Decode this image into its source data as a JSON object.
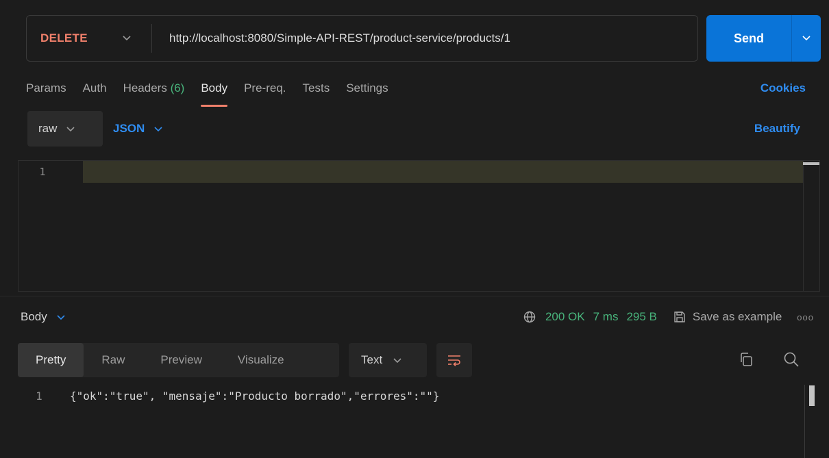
{
  "request": {
    "method": "DELETE",
    "url": "http://localhost:8080/Simple-API-REST/product-service/products/1",
    "send_label": "Send"
  },
  "tabs": [
    {
      "label": "Params"
    },
    {
      "label": "Auth"
    },
    {
      "label": "Headers",
      "count": "(6)"
    },
    {
      "label": "Body"
    },
    {
      "label": "Pre-req."
    },
    {
      "label": "Tests"
    },
    {
      "label": "Settings"
    }
  ],
  "active_tab": "Body",
  "cookies_label": "Cookies",
  "body_type": {
    "mode": "raw",
    "format": "JSON"
  },
  "beautify_label": "Beautify",
  "editor": {
    "line_number": "1",
    "content": ""
  },
  "response": {
    "section_label": "Body",
    "status": "200 OK",
    "time": "7 ms",
    "size": "295 B",
    "save_label": "Save as example",
    "more_label": "ooo",
    "view_tabs": [
      "Pretty",
      "Raw",
      "Preview",
      "Visualize"
    ],
    "active_view": "Pretty",
    "format": "Text",
    "line_number": "1",
    "body": "{\"ok\":\"true\", \"mensaje\":\"Producto borrado\",\"errores\":\"\"}"
  },
  "colors": {
    "accent": "#0a74d8",
    "method": "#f0806b",
    "success": "#48b37b",
    "link": "#2f8cf0"
  }
}
